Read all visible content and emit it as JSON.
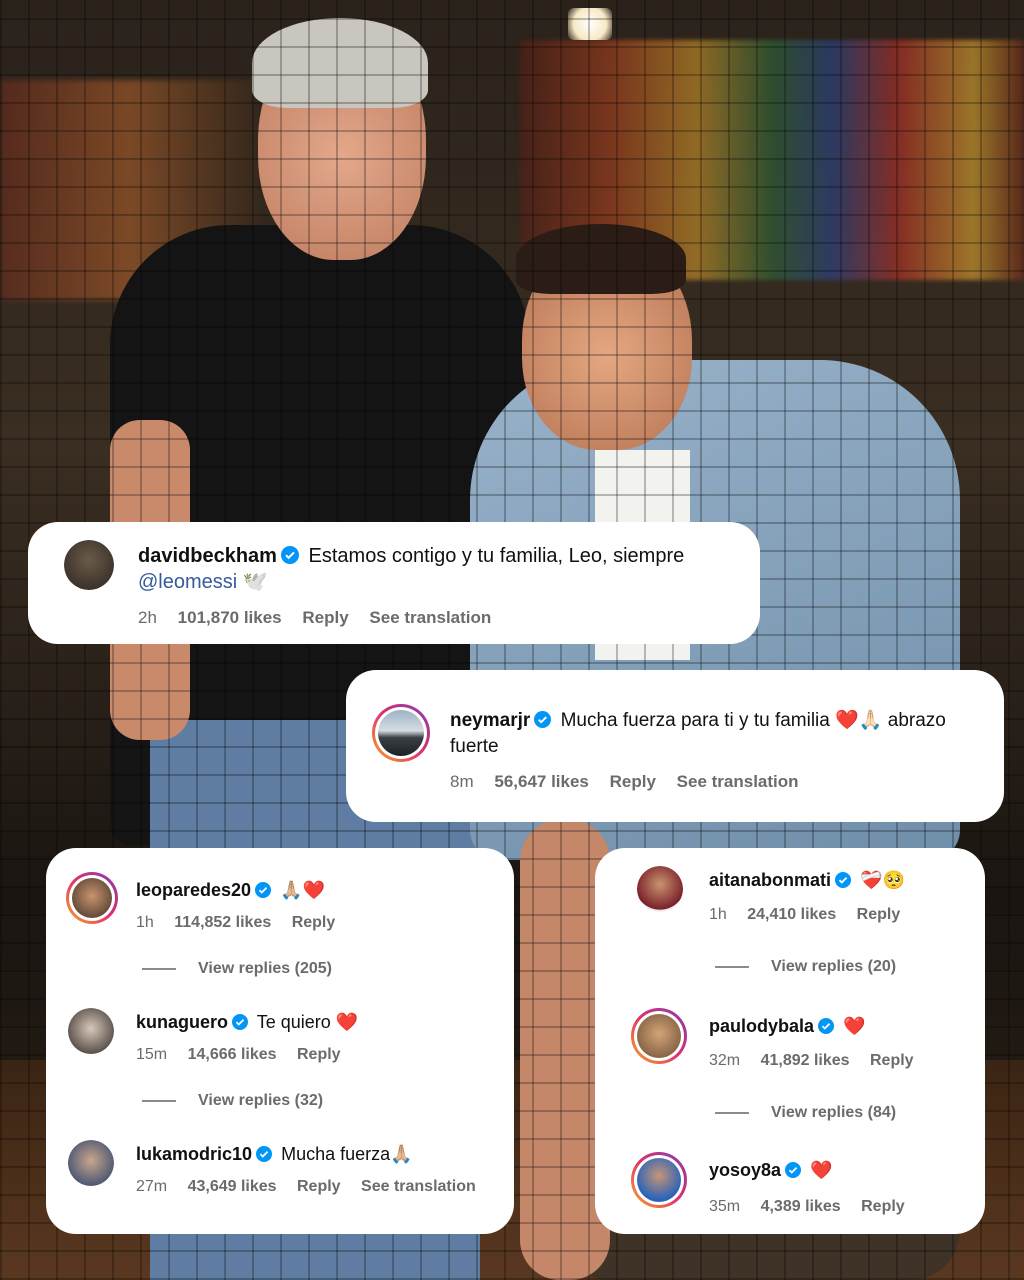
{
  "comments": {
    "beckham": {
      "username": "davidbeckham",
      "text": "Estamos contigo y tu familia, Leo, siempre",
      "mention": "@leomessi",
      "emoji": "🕊️",
      "time": "2h",
      "likes": "101,870 likes",
      "reply": "Reply",
      "translation": "See translation"
    },
    "neymar": {
      "username": "neymarjr",
      "text": "Mucha fuerza para ti y tu familia",
      "emoji": "❤️🙏🏻",
      "text2": "abrazo",
      "text3": "fuerte",
      "time": "8m",
      "likes": "56,647 likes",
      "reply": "Reply",
      "translation": "See translation"
    },
    "paredes": {
      "username": "leoparedes20",
      "emoji": "🙏🏼❤️",
      "time": "1h",
      "likes": "114,852 likes",
      "reply": "Reply",
      "view_replies": "View replies (205)"
    },
    "aguero": {
      "username": "kunaguero",
      "text": "Te quiero",
      "emoji": "❤️",
      "time": "15m",
      "likes": "14,666 likes",
      "reply": "Reply",
      "view_replies": "View replies (32)"
    },
    "modric": {
      "username": "lukamodric10",
      "text": "Mucha fuerza",
      "emoji": "🙏🏼",
      "time": "27m",
      "likes": "43,649 likes",
      "reply": "Reply",
      "translation": "See translation"
    },
    "bonmati": {
      "username": "aitanabonmati",
      "emoji": "❤️‍🩹🥺",
      "time": "1h",
      "likes": "24,410 likes",
      "reply": "Reply",
      "view_replies": "View replies (20)"
    },
    "dybala": {
      "username": "paulodybala",
      "emoji": "❤️",
      "time": "32m",
      "likes": "41,892 likes",
      "reply": "Reply",
      "view_replies": "View replies (84)"
    },
    "yosoy": {
      "username": "yosoy8a",
      "emoji": "❤️",
      "time": "35m",
      "likes": "4,389 likes",
      "reply": "Reply"
    }
  },
  "colors": {
    "verified": "#0095f6",
    "mention": "#375a9e",
    "meta": "#6b6b6b"
  }
}
